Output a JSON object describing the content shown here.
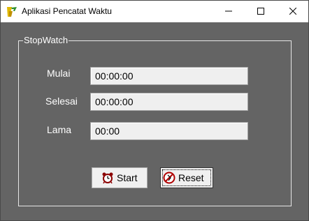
{
  "window": {
    "title": "Aplikasi Pencatat Waktu"
  },
  "group": {
    "legend": "StopWatch"
  },
  "fields": {
    "mulai_label": "Mulai",
    "mulai_value": "00:00:00",
    "selesai_label": "Selesai",
    "selesai_value": "00:00:00",
    "lama_label": "Lama",
    "lama_value": "00:00"
  },
  "buttons": {
    "start_label": "Start",
    "reset_label": "Reset"
  },
  "icons": {
    "app": "app-logo-icon",
    "minimize": "minimize-icon",
    "maximize": "maximize-icon",
    "close": "close-icon",
    "start": "alarm-clock-icon",
    "reset": "stop-icon"
  },
  "colors": {
    "background": "#646464",
    "titlebar": "#ffffff",
    "text_light": "#ffffff",
    "field_bg": "#efefef"
  }
}
